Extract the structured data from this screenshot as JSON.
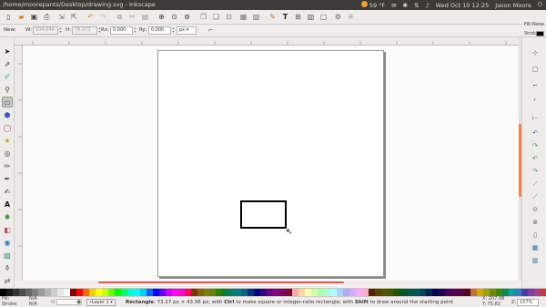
{
  "window": {
    "title": "/home/moorepants/Desktop/drawing.svg - Inkscape"
  },
  "top_panel": {
    "weather": "59 °F",
    "clock": "Wed Oct 10 12:25",
    "user": "Jason Moore"
  },
  "controls": {
    "tool_label": "New:",
    "w_label": "W:",
    "w_value": "104.048",
    "h_label": "H:",
    "h_value": "78.073",
    "rx_label": "Rx:",
    "rx_value": "0.000",
    "ry_label": "Ry:",
    "ry_value": "0.000",
    "unit": "px",
    "fill_label": "Fill:",
    "fill_value": "None",
    "stroke_label": "Stroke:"
  },
  "statusbar": {
    "fill_label": "Fill:",
    "fill_value": "N/A",
    "stroke_label": "Stroke:",
    "stroke_value": "N/A",
    "opacity_label": "O:",
    "layer": "•Layer 1",
    "message_bold": "Rectangle",
    "message": ": 73.27 px × 43.96 px; with ",
    "message_ctrl": "Ctrl",
    "message2": " to make square or integer-ratio rectangle; with ",
    "message_shift": "Shift",
    "message3": " to draw around the starting point",
    "x_label": "X:",
    "x_value": "207.08",
    "y_label": "Y:",
    "y_value": "75.82",
    "zoom_label": "Z:",
    "zoom_value": "157%"
  },
  "colors": {
    "titlebar": "#3c3b37",
    "hscroll_thumb": "#e35c4b"
  },
  "palette": [
    "#000000",
    "#1a1a1a",
    "#333333",
    "#4d4d4d",
    "#666666",
    "#808080",
    "#999999",
    "#b3b3b3",
    "#cccccc",
    "#e6e6e6",
    "#ffffff",
    "#800000",
    "#ff0000",
    "#ff6600",
    "#ffcc00",
    "#ffff00",
    "#ccff00",
    "#66ff00",
    "#00ff00",
    "#00ff66",
    "#00ffcc",
    "#00ffff",
    "#00ccff",
    "#0066ff",
    "#0000ff",
    "#6600ff",
    "#cc00ff",
    "#ff00ff",
    "#ff00cc",
    "#ff0066",
    "#803300",
    "#806600",
    "#808000",
    "#668000",
    "#338000",
    "#008033",
    "#008066",
    "#008080",
    "#006680",
    "#003380",
    "#000080",
    "#330080",
    "#660080",
    "#800080",
    "#800066",
    "#800033",
    "#ffaaaa",
    "#ffd5aa",
    "#ffffaa",
    "#d5ffaa",
    "#aaffaa",
    "#aaffd5",
    "#aaffff",
    "#aad5ff",
    "#aaaaff",
    "#d5aaff",
    "#ffaaff",
    "#ffaad5",
    "#552200",
    "#554400",
    "#555500",
    "#445500",
    "#225500",
    "#005522",
    "#005544",
    "#005555",
    "#004455",
    "#002255",
    "#000055",
    "#220055",
    "#440055",
    "#550055",
    "#550044",
    "#550022",
    "#c87137",
    "#d4aa00",
    "#a0a000",
    "#6f8a00",
    "#3c8a00",
    "#008a55",
    "#00a0a0",
    "#2f7fb7",
    "#3f3fa8",
    "#7a3fa8",
    "#a83f8f",
    "#c83737"
  ]
}
